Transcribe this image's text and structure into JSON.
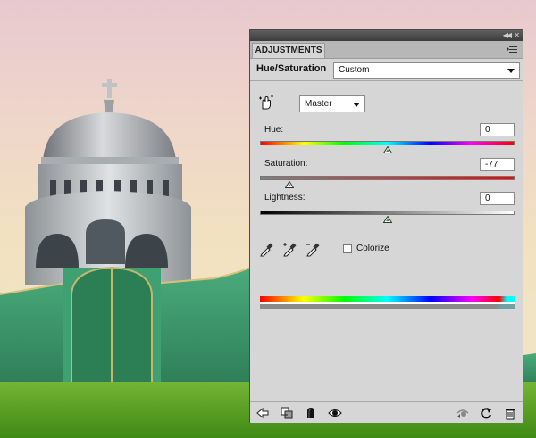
{
  "panel": {
    "tab_label": "ADJUSTMENTS",
    "title": "Hue/Saturation",
    "preset": {
      "selected": "Custom"
    },
    "channel": {
      "selected": "Master"
    },
    "hue": {
      "label": "Hue:",
      "value": "0"
    },
    "saturation": {
      "label": "Saturation:",
      "value": "-77"
    },
    "lightness": {
      "label": "Lightness:",
      "value": "0"
    },
    "colorize": {
      "label": "Colorize",
      "checked": false
    }
  },
  "icons": {
    "collapse": "double-left-arrow-icon",
    "close": "close-icon",
    "panel_menu": "panel-menu-icon",
    "targeted_adjustment": "hand-adjust-icon",
    "eyedroppers": [
      "eyedropper-icon",
      "eyedropper-plus-icon",
      "eyedropper-minus-icon"
    ],
    "bottom": [
      "return-to-list-icon",
      "clip-to-layer-icon",
      "mask-icon",
      "visibility-eye-icon",
      "view-previous-icon",
      "reset-icon",
      "trash-icon"
    ]
  },
  "colors": {
    "panel_bg": "#d6d6d6",
    "titlebar": "#4a4a4a",
    "wall_green": "#3f9a6e",
    "grass_green": "#5a9e24"
  }
}
